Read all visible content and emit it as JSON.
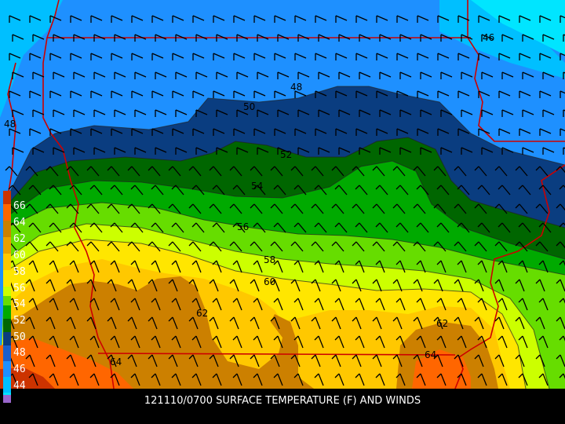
{
  "caption": "121110/0700 SURFACE TEMPERATURE (F) AND WINDS",
  "legend": {
    "colors": [
      "#cc3300",
      "#ff6600",
      "#cc8000",
      "#e8a000",
      "#ffc800",
      "#ffe600",
      "#ccff00",
      "#66dd00",
      "#00aa00",
      "#006600",
      "#0a3d80",
      "#1a5fcc",
      "#1e90ff",
      "#00bfff",
      "#00e5ff",
      "#9966cc"
    ],
    "labels": [
      "66",
      "64",
      "62",
      "60",
      "58",
      "56",
      "54",
      "52",
      "50",
      "48",
      "46",
      "44"
    ]
  },
  "contour_labels": [
    {
      "text": "46"
    },
    {
      "text": "48"
    },
    {
      "text": "48"
    },
    {
      "text": "50"
    },
    {
      "text": "52"
    },
    {
      "text": "54"
    },
    {
      "text": "56"
    },
    {
      "text": "58"
    },
    {
      "text": "60"
    },
    {
      "text": "62"
    },
    {
      "text": "62"
    },
    {
      "text": "64"
    },
    {
      "text": "64"
    }
  ],
  "bands": {
    "b44": "#00e5ff",
    "b46": "#00bfff",
    "b48": "#1e90ff",
    "b50": "#0a3d80",
    "b52": "#006600",
    "b54": "#00aa00",
    "b56": "#66dd00",
    "b58": "#ccff00",
    "b60": "#ffe600",
    "b62": "#ffc800",
    "b64": "#cc8000",
    "b66": "#ff6600"
  },
  "border_color": "#cc0000"
}
